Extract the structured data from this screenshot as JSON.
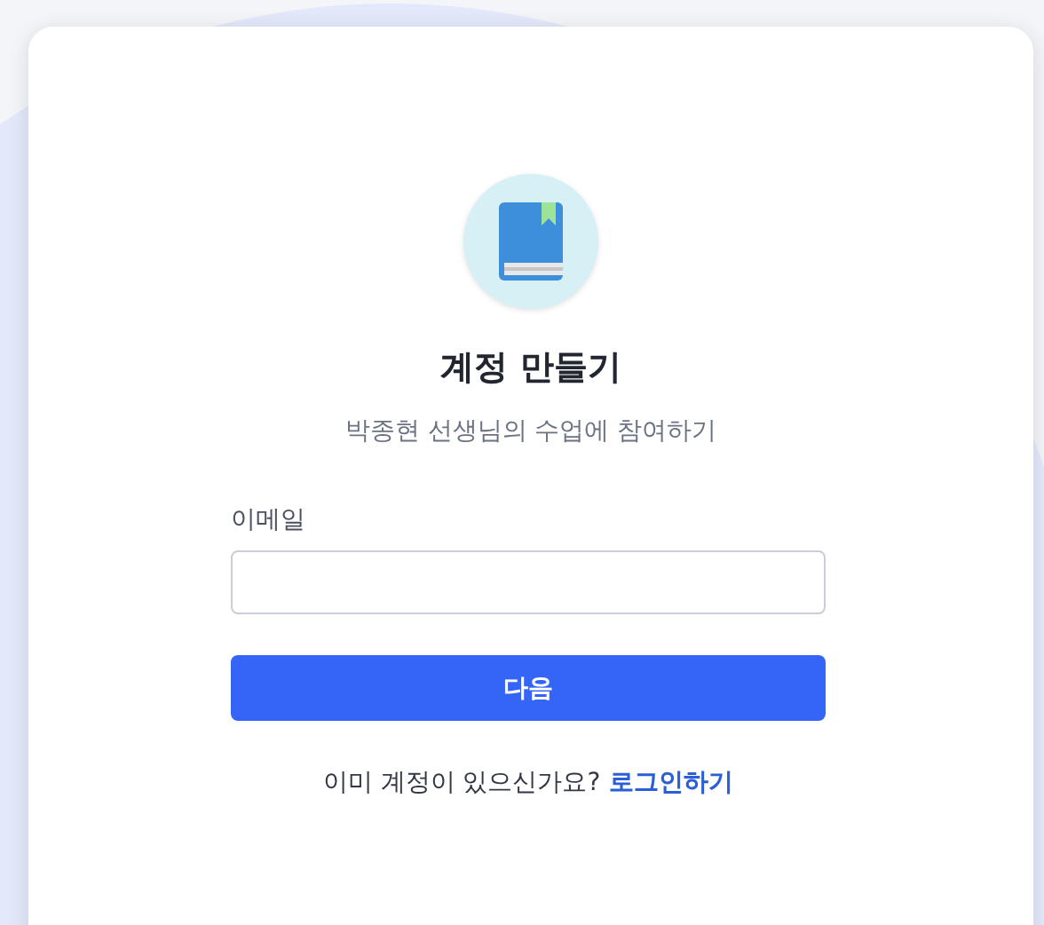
{
  "title": "계정 만들기",
  "subtitle": "박종현 선생님의 수업에 참여하기",
  "email_field": {
    "label": "이메일"
  },
  "next_button": "다음",
  "footer": {
    "text": "이미 계정이 있으신가요?",
    "link": "로그인하기"
  }
}
